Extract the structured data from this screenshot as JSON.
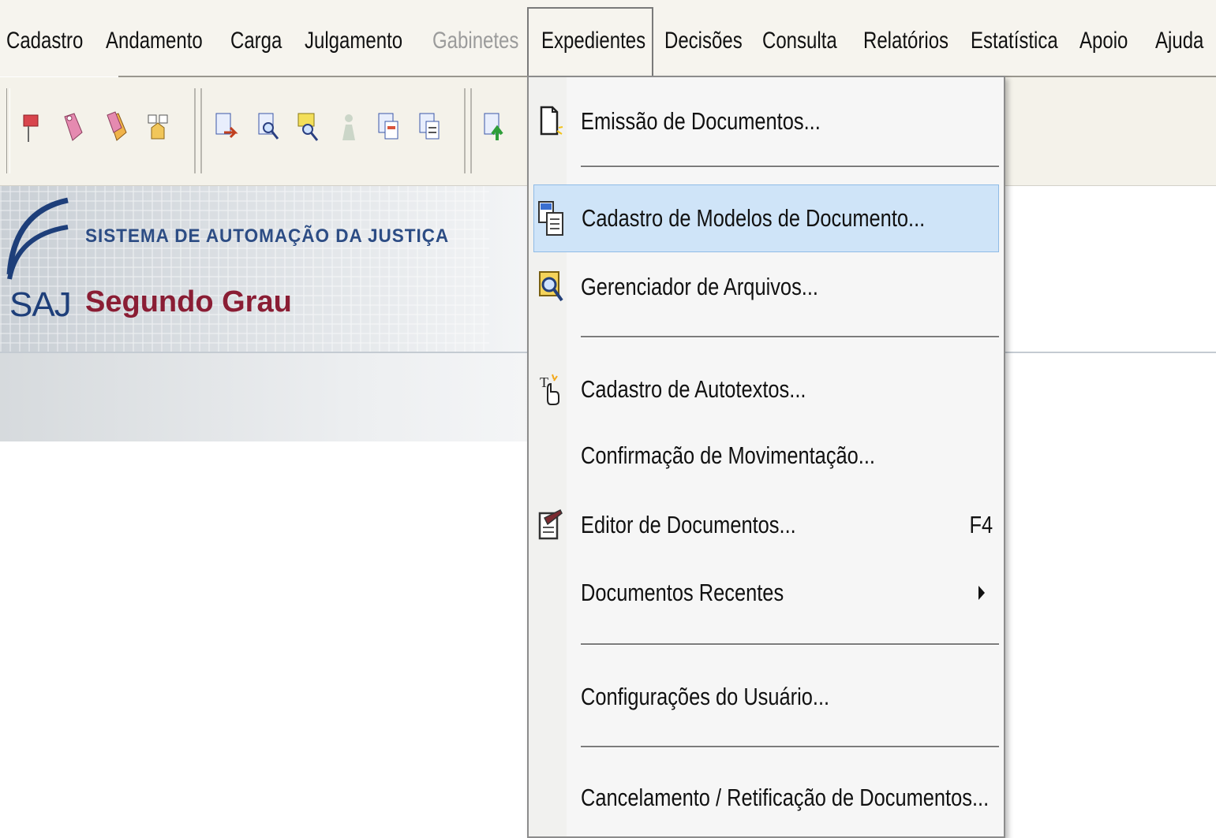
{
  "menu_bar": {
    "items": [
      {
        "label": "Cadastro",
        "disabled": false
      },
      {
        "label": "Andamento",
        "disabled": false
      },
      {
        "label": "Carga",
        "disabled": false
      },
      {
        "label": "Julgamento",
        "disabled": false
      },
      {
        "label": "Gabinetes",
        "disabled": true
      },
      {
        "label": "Expedientes",
        "disabled": false,
        "active": true
      },
      {
        "label": "Decisões",
        "disabled": false
      },
      {
        "label": "Consulta",
        "disabled": false
      },
      {
        "label": "Relatórios",
        "disabled": false
      },
      {
        "label": "Estatística",
        "disabled": false
      },
      {
        "label": "Apoio",
        "disabled": false
      },
      {
        "label": "Ajuda",
        "disabled": false
      }
    ]
  },
  "banner": {
    "system_name": "SISTEMA DE AUTOMAÇÃO DA JUSTIÇA",
    "logo_text": "SAJ",
    "subtitle": "Segundo Grau",
    "logo_color": "#1e3f7a",
    "subtitle_color": "#8a1d34"
  },
  "dropdown": {
    "items": [
      {
        "label": "Emissão de Documentos...",
        "icon": "document-icon"
      },
      {
        "label": "Cadastro de Modelos de Documento...",
        "icon": "document-models-icon",
        "highlighted": true
      },
      {
        "label": "Gerenciador de Arquivos...",
        "icon": "file-search-icon"
      },
      {
        "label": "Cadastro de Autotextos...",
        "icon": "autotext-icon"
      },
      {
        "label": "Confirmação de Movimentação...",
        "icon": ""
      },
      {
        "label": "Editor de Documentos...",
        "icon": "document-editor-icon",
        "shortcut": "F4"
      },
      {
        "label": "Documentos Recentes",
        "icon": "",
        "submenu": true
      },
      {
        "label": "Configurações do Usuário...",
        "icon": ""
      },
      {
        "label": "Cancelamento / Retificação de Documentos...",
        "icon": ""
      }
    ],
    "highlight_color": "#cfe4f8"
  }
}
